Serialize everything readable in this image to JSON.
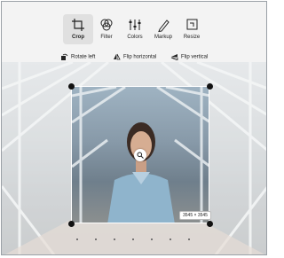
{
  "toolbar": {
    "tools": [
      {
        "label": "Crop",
        "icon": "crop-icon",
        "active": true
      },
      {
        "label": "Filter",
        "icon": "filter-icon",
        "active": false
      },
      {
        "label": "Colors",
        "icon": "colors-icon",
        "active": false
      },
      {
        "label": "Markup",
        "icon": "markup-icon",
        "active": false
      },
      {
        "label": "Resize",
        "icon": "resize-icon",
        "active": false
      }
    ]
  },
  "crop_actions": {
    "rotate_left": "Rotate left",
    "flip_horizontal": "Flip horizontal",
    "flip_vertical": "Flip vertical"
  },
  "image": {
    "dimensions_label": "3545 × 3545"
  },
  "colors": {
    "background": "#f3f3f3",
    "active_tool_bg": "#e0e0e0",
    "handle": "#111111"
  }
}
